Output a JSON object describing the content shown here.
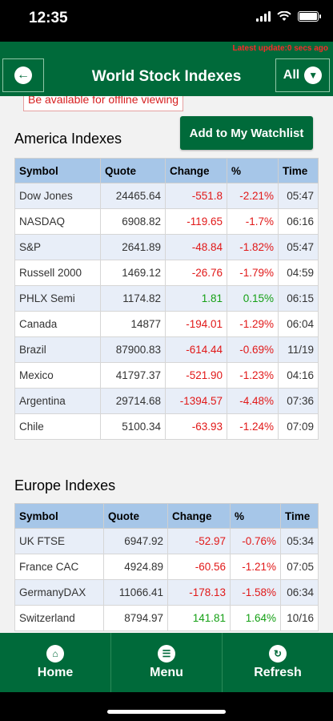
{
  "status": {
    "time": "12:35"
  },
  "header": {
    "latest_update": "Latest update:0 secs ago",
    "title": "World Stock Indexes",
    "filter_label": "All"
  },
  "tooltip": "Be available for offline viewing",
  "watchlist_button": "Add to My Watchlist",
  "columns": [
    "Symbol",
    "Quote",
    "Change",
    "%",
    "Time"
  ],
  "america": {
    "title": "America Indexes",
    "rows": [
      {
        "symbol": "Dow Jones",
        "quote": "24465.64",
        "change": "-551.8",
        "pct": "-2.21%",
        "time": "05:47"
      },
      {
        "symbol": "NASDAQ",
        "quote": "6908.82",
        "change": "-119.65",
        "pct": "-1.7%",
        "time": "06:16"
      },
      {
        "symbol": "S&P",
        "quote": "2641.89",
        "change": "-48.84",
        "pct": "-1.82%",
        "time": "05:47"
      },
      {
        "symbol": "Russell 2000",
        "quote": "1469.12",
        "change": "-26.76",
        "pct": "-1.79%",
        "time": "04:59"
      },
      {
        "symbol": "PHLX Semi",
        "quote": "1174.82",
        "change": "1.81",
        "pct": "0.15%",
        "time": "06:15"
      },
      {
        "symbol": "Canada",
        "quote": "14877",
        "change": "-194.01",
        "pct": "-1.29%",
        "time": "06:04"
      },
      {
        "symbol": "Brazil",
        "quote": "87900.83",
        "change": "-614.44",
        "pct": "-0.69%",
        "time": "11/19"
      },
      {
        "symbol": "Mexico",
        "quote": "41797.37",
        "change": "-521.90",
        "pct": "-1.23%",
        "time": "04:16"
      },
      {
        "symbol": "Argentina",
        "quote": "29714.68",
        "change": "-1394.57",
        "pct": "-4.48%",
        "time": "07:36"
      },
      {
        "symbol": "Chile",
        "quote": "5100.34",
        "change": "-63.93",
        "pct": "-1.24%",
        "time": "07:09"
      }
    ]
  },
  "europe": {
    "title": "Europe Indexes",
    "rows": [
      {
        "symbol": "UK FTSE",
        "quote": "6947.92",
        "change": "-52.97",
        "pct": "-0.76%",
        "time": "05:34"
      },
      {
        "symbol": "France CAC",
        "quote": "4924.89",
        "change": "-60.56",
        "pct": "-1.21%",
        "time": "07:05"
      },
      {
        "symbol": "GermanyDAX",
        "quote": "11066.41",
        "change": "-178.13",
        "pct": "-1.58%",
        "time": "06:34"
      },
      {
        "symbol": "Switzerland",
        "quote": "8794.97",
        "change": "141.81",
        "pct": "1.64%",
        "time": "10/16"
      }
    ]
  },
  "tabs": [
    {
      "label": "Home",
      "icon": "home-icon"
    },
    {
      "label": "Menu",
      "icon": "menu-icon"
    },
    {
      "label": "Refresh",
      "icon": "refresh-icon"
    }
  ],
  "colors": {
    "brand_green": "#006a3a",
    "negative": "#e11818",
    "positive": "#15a015",
    "header_blue": "#a6c6e8"
  }
}
